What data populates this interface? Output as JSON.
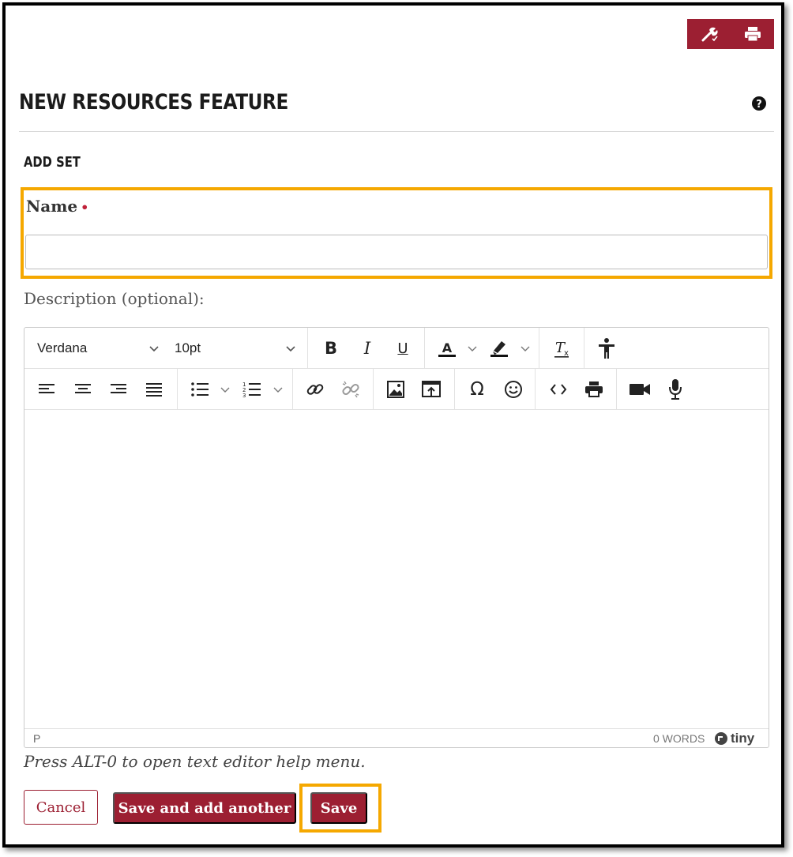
{
  "page": {
    "title": "NEW RESOURCES FEATURE",
    "section": "ADD SET"
  },
  "form": {
    "name_label": "Name",
    "required_marker": "•",
    "name_value": "",
    "description_label": "Description (optional):"
  },
  "editor": {
    "font_family": "Verdana",
    "font_size": "10pt",
    "status_path": "P",
    "word_count": "0 WORDS",
    "brand": "tiny",
    "help_text": "Press ALT-0 to open text editor help menu."
  },
  "buttons": {
    "cancel": "Cancel",
    "save_and_add": "Save and add another",
    "save": "Save"
  },
  "colors": {
    "brand": "#9c1f32",
    "highlight": "#f5a800"
  },
  "icons": {
    "top_toolbar": [
      "wrench-icon",
      "print-icon"
    ],
    "editor_row1": [
      "bold-icon",
      "italic-icon",
      "underline-icon",
      "text-color-icon",
      "highlight-color-icon",
      "clear-formatting-icon",
      "accessibility-icon"
    ],
    "editor_row2": [
      "align-left-icon",
      "align-center-icon",
      "align-right-icon",
      "justify-icon",
      "bullet-list-icon",
      "numbered-list-icon",
      "link-icon",
      "unlink-icon",
      "image-icon",
      "embed-icon",
      "special-char-icon",
      "emoji-icon",
      "source-code-icon",
      "print-icon",
      "video-icon",
      "microphone-icon"
    ]
  }
}
